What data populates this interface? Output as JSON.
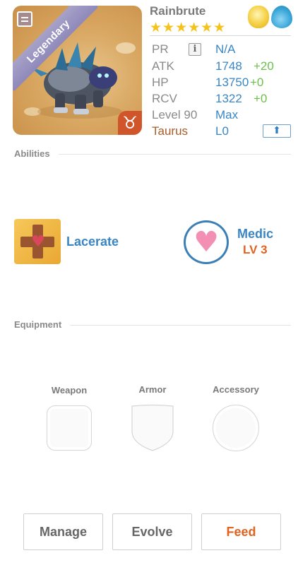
{
  "creature": {
    "name": "Rainbrute",
    "rarity": "Legendary",
    "stars": 6,
    "stars_display": "★★★★★★",
    "zodiac_symbol": "♉",
    "elements": [
      "light-element-icon",
      "water-element-icon"
    ]
  },
  "stats": [
    {
      "label": "PR",
      "value": "N/A",
      "bonus": ""
    },
    {
      "label": "ATK",
      "value": "1748",
      "bonus": "+20"
    },
    {
      "label": "HP",
      "value": "13750",
      "bonus": "+0"
    },
    {
      "label": "RCV",
      "value": "1322",
      "bonus": "+0"
    },
    {
      "label": "Level 90",
      "value": "Max",
      "bonus": ""
    },
    {
      "label": "Taurus",
      "value": "L0",
      "bonus": ""
    }
  ],
  "info_glyph": "i",
  "upgrade_glyph": "⬆",
  "sections": {
    "abilities": "Abilities",
    "equipment": "Equipment"
  },
  "abilities": {
    "left": {
      "name": "Lacerate",
      "icon": "lacerate-icon"
    },
    "right": {
      "name": "Medic",
      "level": "LV 3",
      "icon": "medic-heart-icon"
    }
  },
  "glyphs": {
    "heart": "♥"
  },
  "equipment": {
    "weapon": "Weapon",
    "armor": "Armor",
    "accessory": "Accessory"
  },
  "buttons": {
    "manage": "Manage",
    "evolve": "Evolve",
    "feed": "Feed"
  },
  "colors": {
    "accent_blue": "#3a86c4",
    "bonus_green": "#6cc04a",
    "feed_orange": "#e2621e",
    "legendary_ribbon": "#9b97c4",
    "star_gold": "#f5c21b"
  }
}
